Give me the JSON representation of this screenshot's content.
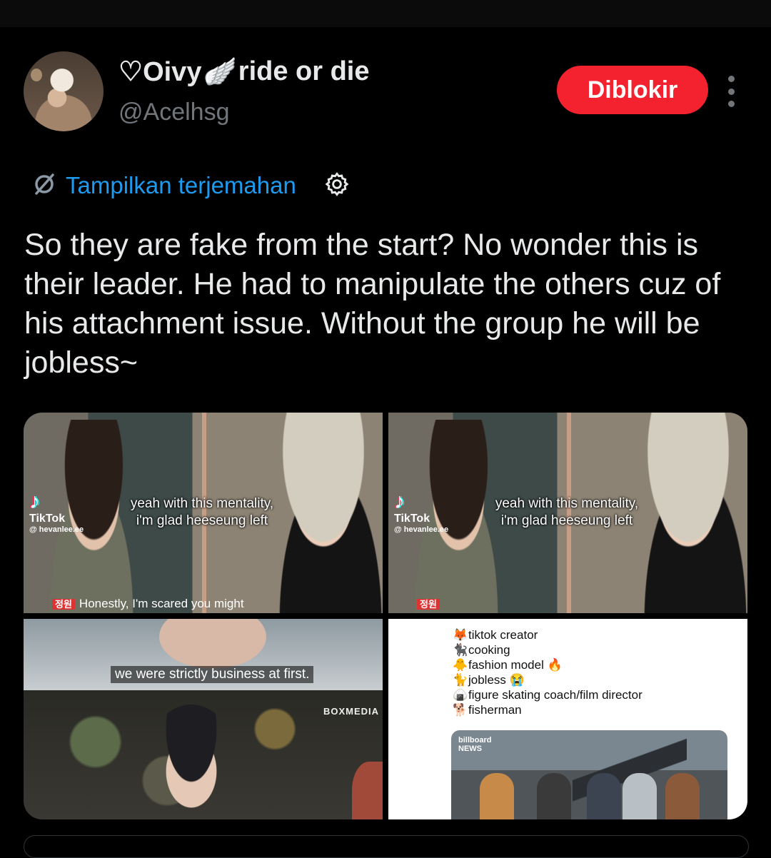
{
  "profile": {
    "display_name_prefix": "♡Oivy",
    "wing_icon": "🪽",
    "display_name_suffix": "ride or die",
    "handle": "@Acelhsg"
  },
  "actions": {
    "blocked_label": "Diblokir"
  },
  "translate": {
    "label": "Tampilkan terjemahan"
  },
  "tweet": {
    "text": "So they are fake from the start? No wonder this is their leader. He had to manipulate the others cuz of his attachment issue. Without the group he will be jobless~"
  },
  "media": {
    "panel1": {
      "tiktok_label": "TikTok",
      "tiktok_user": "@ hevanlee.ee",
      "caption_line1": "yeah with this mentality,",
      "caption_line2": "i'm glad heeseung left",
      "subtitle": "Honestly, I'm scared you might"
    },
    "panel2": {
      "tiktok_label": "TikTok",
      "tiktok_user": "@ hevanlee.ee",
      "caption_line1": "yeah with this mentality,",
      "caption_line2": "i'm glad heeseung left"
    },
    "panel3": {
      "subtitle": "we were strictly business at first.",
      "brand": "BOXMEDIA"
    },
    "panel4": {
      "bio": [
        {
          "emoji": "🦊",
          "text": "tiktok creator"
        },
        {
          "emoji": "🐈‍⬛",
          "text": "cooking"
        },
        {
          "emoji": "🐥",
          "text": "fashion model 🔥"
        },
        {
          "emoji": "🐈",
          "text": "jobless 😭"
        },
        {
          "emoji": "🍙",
          "text": "figure skating coach/film director"
        },
        {
          "emoji": "🐕",
          "text": "fisherman"
        }
      ],
      "thumb_badge_line1": "billboard",
      "thumb_badge_line2": "NEWS"
    }
  },
  "colors": {
    "background": "#000000",
    "text": "#e7e9ea",
    "muted": "#71767b",
    "link": "#1d9bf0",
    "blocked": "#f4212e"
  }
}
